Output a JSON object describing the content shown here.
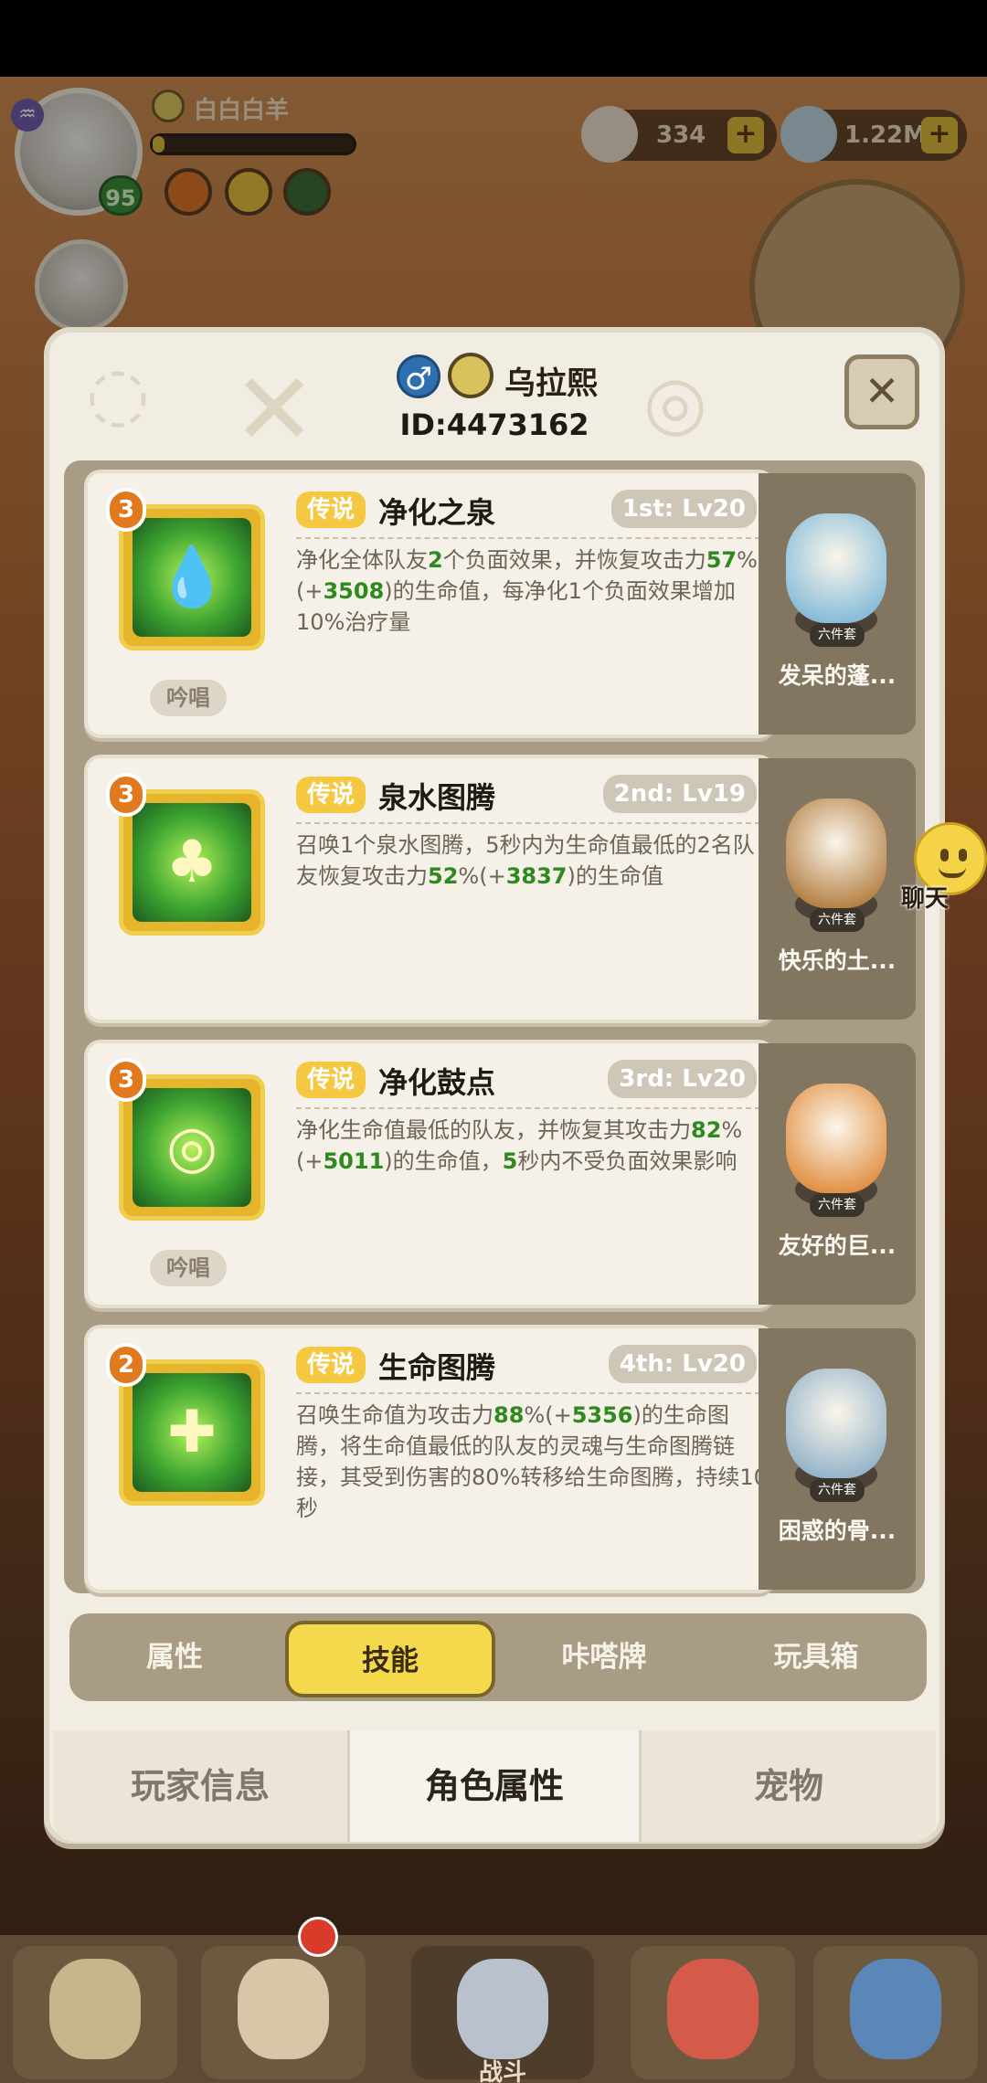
{
  "hud": {
    "player_name": "白白白羊",
    "player_level": "95",
    "xp_progress": 0.06,
    "resources": [
      {
        "icon": "shell-icon",
        "value": "334"
      },
      {
        "icon": "pearl-icon",
        "value": "1.22M"
      }
    ]
  },
  "modal": {
    "player_name": "乌拉熙",
    "player_id": "ID:4473162",
    "close_glyph": "✕"
  },
  "skills": [
    {
      "rank": "3",
      "rarity": "传说",
      "name": "净化之泉",
      "level": "1st: Lv20",
      "desc_parts": [
        {
          "t": "净化全体队友"
        },
        {
          "t": "2",
          "g": true
        },
        {
          "t": "个负面效果，并恢复攻击力"
        },
        {
          "t": "57",
          "g": true
        },
        {
          "t": "%(+"
        },
        {
          "t": "3508",
          "g": true
        },
        {
          "t": ")的生命值，每净化1个负面效果增加10%治疗量"
        }
      ],
      "chant": "吟唱",
      "icon": "spring-drop-icon",
      "glyph": "💧"
    },
    {
      "rank": "3",
      "rarity": "传说",
      "name": "泉水图腾",
      "level": "2nd: Lv19",
      "desc_parts": [
        {
          "t": "召唤1个泉水图腾，5秒内为生命值最低的2名队友恢复攻击力"
        },
        {
          "t": "52",
          "g": true
        },
        {
          "t": "%(+"
        },
        {
          "t": "3837",
          "g": true
        },
        {
          "t": ")的生命值"
        }
      ],
      "chant": "",
      "icon": "totem-icon",
      "glyph": "♣"
    },
    {
      "rank": "3",
      "rarity": "传说",
      "name": "净化鼓点",
      "level": "3rd: Lv20",
      "desc_parts": [
        {
          "t": "净化生命值最低的队友，并恢复其攻击力"
        },
        {
          "t": "82",
          "g": true
        },
        {
          "t": "%(+"
        },
        {
          "t": "5011",
          "g": true
        },
        {
          "t": ")的生命值，"
        },
        {
          "t": "5",
          "g": true
        },
        {
          "t": "秒内不受负面效果影响"
        }
      ],
      "chant": "吟唱",
      "icon": "drum-icon",
      "glyph": "◎"
    },
    {
      "rank": "2",
      "rarity": "传说",
      "name": "生命图腾",
      "level": "4th: Lv20",
      "desc_parts": [
        {
          "t": "召唤生命值为攻击力"
        },
        {
          "t": "88",
          "g": true
        },
        {
          "t": "%(+"
        },
        {
          "t": "5356",
          "g": true
        },
        {
          "t": ")的生命图腾，将生命值最低的队友的灵魂与生命图腾链接，其受到伤害的80%转移给生命图腾，持续10秒"
        }
      ],
      "chant": "",
      "icon": "life-totem-icon",
      "glyph": "✚"
    }
  ],
  "pets": [
    {
      "name": "发呆的蓬...",
      "set": "六件套",
      "color": "#7fb8d8"
    },
    {
      "name": "快乐的土...",
      "set": "六件套",
      "color": "#b07a3c"
    },
    {
      "name": "友好的巨...",
      "set": "六件套",
      "color": "#e08a3a"
    },
    {
      "name": "困惑的骨...",
      "set": "六件套",
      "color": "#8fb0c8"
    }
  ],
  "subtabs": [
    "属性",
    "技能",
    "咔嗒牌",
    "玩具箱"
  ],
  "active_subtab": 1,
  "bottom_tabs": [
    "玩家信息",
    "角色属性",
    "宠物"
  ],
  "active_bottom_tab": 1,
  "chat_label": "聊天",
  "nav": {
    "battle_label": "战斗"
  }
}
